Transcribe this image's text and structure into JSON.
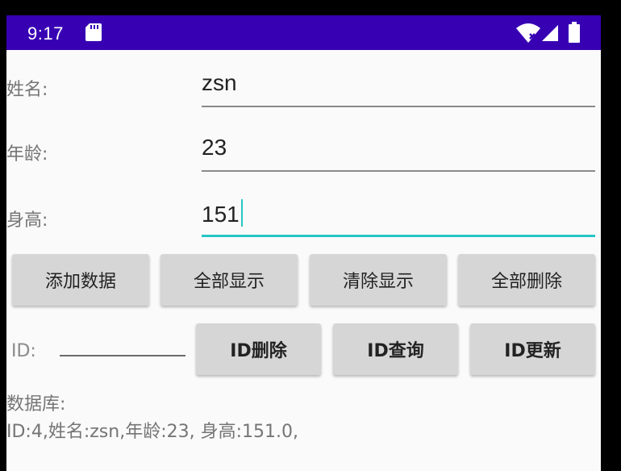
{
  "status_bar": {
    "time": "9:17",
    "icons": [
      "sd-card-icon",
      "wifi-icon",
      "signal-icon",
      "battery-icon"
    ],
    "color": "#3700b3"
  },
  "form": {
    "name_label": "姓名:",
    "name_value": "zsn",
    "age_label": "年龄:",
    "age_value": "23",
    "height_label": "身高:",
    "height_value": "151"
  },
  "buttons_row1": {
    "add": "添加数据",
    "show_all": "全部显示",
    "clear_display": "清除显示",
    "delete_all": "全部删除"
  },
  "id_row": {
    "label": "ID:",
    "id_value": "",
    "delete": "ID删除",
    "query": "ID查询",
    "update": "ID更新"
  },
  "database": {
    "label": "数据库:",
    "output": "ID:4,姓名:zsn,年龄:23, 身高:151.0,"
  },
  "colors": {
    "accent": "#26c6c6",
    "button": "#d6d6d6",
    "background": "#fafafa"
  }
}
